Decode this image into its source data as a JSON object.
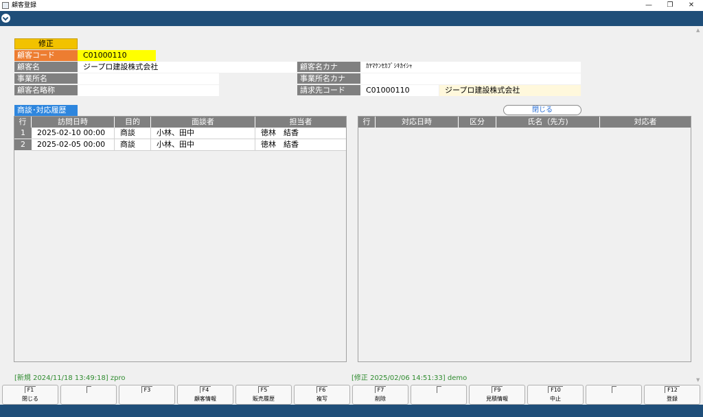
{
  "window": {
    "title": "顧客登録",
    "minimize": "—",
    "restore": "❐",
    "close": "✕"
  },
  "form": {
    "mode": "修正",
    "customer_code_label": "顧客コード",
    "customer_code": "C01000110",
    "customer_name_label": "顧客名",
    "customer_name": "ジープロ建設株式会社",
    "office_name_label": "事業所名",
    "office_name": "",
    "short_name_label": "顧客名略称",
    "short_name": "",
    "name_kana_label": "顧客名カナ",
    "name_kana": "ｶﾔﾏｹﾝｾｶﾌﾞｼｷｶｲｼｬ",
    "office_kana_label": "事業所名カナ",
    "office_kana": "",
    "billing_code_label": "請求先コード",
    "billing_code": "C01000110",
    "billing_name": "ジープロ建設株式会社"
  },
  "history": {
    "label": "商談･対応履歴",
    "close_label": "閉じる",
    "left_columns": [
      "行",
      "訪問日時",
      "目的",
      "面談者",
      "担当者"
    ],
    "left_rows": [
      {
        "no": "1",
        "datetime": "2025-02-10 00:00",
        "purpose": "商談",
        "attendees": "小林、田中",
        "staff": "徳林　結香"
      },
      {
        "no": "2",
        "datetime": "2025-02-05 00:00",
        "purpose": "商談",
        "attendees": "小林、田中",
        "staff": "徳林　結香"
      }
    ],
    "right_columns": [
      "行",
      "対応日時",
      "区分",
      "氏名（先方)",
      "対応者"
    ]
  },
  "status": {
    "created": "[新規 2024/11/18 13:49:18] zpro",
    "modified": "[修正 2025/02/06 14:51:33] demo"
  },
  "function_keys": [
    {
      "key": "F1",
      "label": "閉じる"
    },
    {
      "key": "",
      "label": ""
    },
    {
      "key": "F3",
      "label": ""
    },
    {
      "key": "F4",
      "label": "顧客情報"
    },
    {
      "key": "F5",
      "label": "販売履歴"
    },
    {
      "key": "F6",
      "label": "複写"
    },
    {
      "key": "F7",
      "label": "削除"
    },
    {
      "key": "",
      "label": ""
    },
    {
      "key": "F9",
      "label": "見積情報"
    },
    {
      "key": "F10",
      "label": "中止"
    },
    {
      "key": "",
      "label": ""
    },
    {
      "key": "F12",
      "label": "登録"
    }
  ]
}
